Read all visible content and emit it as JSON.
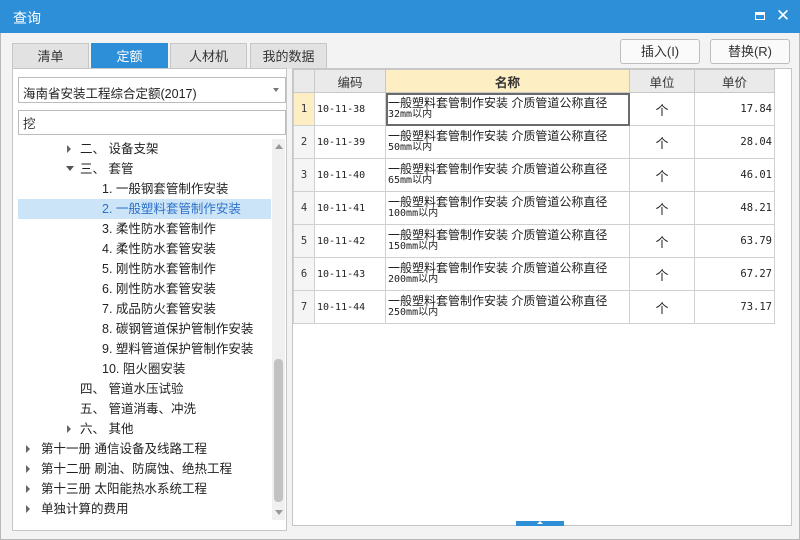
{
  "window": {
    "title": "查询"
  },
  "tabs": [
    {
      "label": "清单",
      "active": false
    },
    {
      "label": "定额",
      "active": true
    },
    {
      "label": "人材机",
      "active": false
    },
    {
      "label": "我的数据",
      "active": false
    }
  ],
  "toolbar": {
    "insert_label": "插入(I)",
    "replace_label": "替换(R)"
  },
  "quota_library": {
    "selected": "海南省安装工程综合定额(2017)"
  },
  "search": {
    "value": "挖",
    "placeholder": ""
  },
  "tree": {
    "nodes": [
      {
        "label": "二、 设备支架",
        "expander": "closed",
        "selected": false
      },
      {
        "label": "三、 套管",
        "expander": "open",
        "selected": false
      },
      {
        "label": "1. 一般钢套管制作安装",
        "expander": "none",
        "selected": false
      },
      {
        "label": "2. 一般塑料套管制作安装",
        "expander": "none",
        "selected": true
      },
      {
        "label": "3. 柔性防水套管制作",
        "expander": "none",
        "selected": false
      },
      {
        "label": "4. 柔性防水套管安装",
        "expander": "none",
        "selected": false
      },
      {
        "label": "5. 刚性防水套管制作",
        "expander": "none",
        "selected": false
      },
      {
        "label": "6. 刚性防水套管安装",
        "expander": "none",
        "selected": false
      },
      {
        "label": "7. 成品防火套管安装",
        "expander": "none",
        "selected": false
      },
      {
        "label": "8. 碳钢管道保护管制作安装",
        "expander": "none",
        "selected": false
      },
      {
        "label": "9. 塑料管道保护管制作安装",
        "expander": "none",
        "selected": false
      },
      {
        "label": "10. 阻火圈安装",
        "expander": "none",
        "selected": false
      },
      {
        "label": "四、 管道水压试验",
        "expander": "none",
        "selected": false
      },
      {
        "label": "五、 管道消毒、冲洗",
        "expander": "none",
        "selected": false
      },
      {
        "label": "六、 其他",
        "expander": "closed",
        "selected": false
      },
      {
        "label": "第十一册 通信设备及线路工程",
        "expander": "closed",
        "selected": false
      },
      {
        "label": "第十二册 刷油、防腐蚀、绝热工程",
        "expander": "closed",
        "selected": false
      },
      {
        "label": "第十三册 太阳能热水系统工程",
        "expander": "closed",
        "selected": false
      },
      {
        "label": "单独计算的费用",
        "expander": "closed",
        "selected": false
      }
    ]
  },
  "grid": {
    "columns": {
      "code": "编码",
      "name": "名称",
      "unit": "单位",
      "price": "单价"
    },
    "rows": [
      {
        "no": "1",
        "code": "10-11-38",
        "name": "一般塑料套管制作安装 介质管道公称直径",
        "spec": "32mm以内",
        "unit": "个",
        "price": "17.84",
        "selected": true
      },
      {
        "no": "2",
        "code": "10-11-39",
        "name": "一般塑料套管制作安装 介质管道公称直径",
        "spec": "50mm以内",
        "unit": "个",
        "price": "28.04",
        "selected": false
      },
      {
        "no": "3",
        "code": "10-11-40",
        "name": "一般塑料套管制作安装 介质管道公称直径",
        "spec": "65mm以内",
        "unit": "个",
        "price": "46.01",
        "selected": false
      },
      {
        "no": "4",
        "code": "10-11-41",
        "name": "一般塑料套管制作安装 介质管道公称直径",
        "spec": "100mm以内",
        "unit": "个",
        "price": "48.21",
        "selected": false
      },
      {
        "no": "5",
        "code": "10-11-42",
        "name": "一般塑料套管制作安装 介质管道公称直径",
        "spec": "150mm以内",
        "unit": "个",
        "price": "63.79",
        "selected": false
      },
      {
        "no": "6",
        "code": "10-11-43",
        "name": "一般塑料套管制作安装 介质管道公称直径",
        "spec": "200mm以内",
        "unit": "个",
        "price": "67.27",
        "selected": false
      },
      {
        "no": "7",
        "code": "10-11-44",
        "name": "一般塑料套管制作安装 介质管道公称直径",
        "spec": "250mm以内",
        "unit": "个",
        "price": "73.17",
        "selected": false
      }
    ]
  },
  "colors": {
    "accent": "#2e8fd9",
    "selected_row": "#cce4f7",
    "header_highlight": "#fdeec4"
  }
}
